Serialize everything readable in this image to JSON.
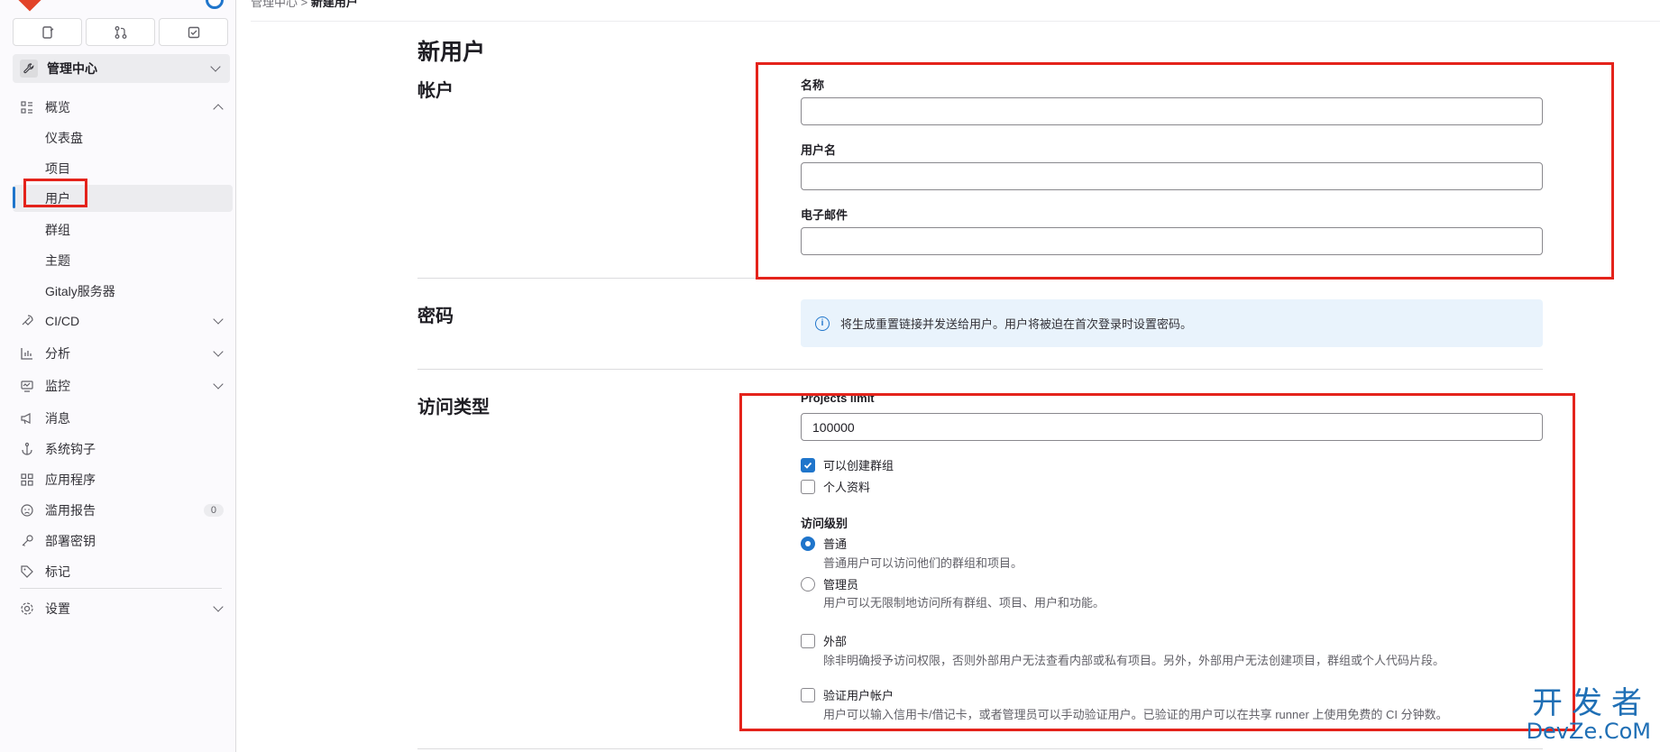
{
  "sidebar": {
    "context_label": "管理中心",
    "items": [
      {
        "label": "概览",
        "icon": "overview-icon"
      },
      {
        "label": "仪表盘"
      },
      {
        "label": "项目"
      },
      {
        "label": "用户"
      },
      {
        "label": "群组"
      },
      {
        "label": "主题"
      },
      {
        "label": "Gitaly服务器"
      },
      {
        "label": "CI/CD",
        "icon": "rocket-icon"
      },
      {
        "label": "分析",
        "icon": "chart-icon"
      },
      {
        "label": "监控",
        "icon": "monitor-icon"
      },
      {
        "label": "消息",
        "icon": "bullhorn-icon"
      },
      {
        "label": "系统钩子",
        "icon": "anchor-icon"
      },
      {
        "label": "应用程序",
        "icon": "applications-icon"
      },
      {
        "label": "滥用报告",
        "icon": "abuse-icon",
        "count": "0"
      },
      {
        "label": "部署密钥",
        "icon": "key-icon"
      },
      {
        "label": "标记",
        "icon": "label-icon"
      },
      {
        "label": "设置",
        "icon": "settings-icon"
      }
    ]
  },
  "breadcrumb": {
    "parent": "管理中心",
    "sep": ">",
    "current": "新建用户"
  },
  "page": {
    "title": "新用户",
    "account": {
      "heading": "帐户",
      "name_label": "名称",
      "name_value": "",
      "username_label": "用户名",
      "username_value": "",
      "email_label": "电子邮件",
      "email_value": ""
    },
    "password": {
      "heading": "密码",
      "info": "将生成重置链接并发送给用户。用户将被迫在首次登录时设置密码。"
    },
    "access": {
      "heading": "访问类型",
      "projects_limit_label": "Projects limit",
      "projects_limit_value": "100000",
      "can_create_group": "可以创建群组",
      "private_profile": "个人资料",
      "access_level_label": "访问级别",
      "regular": "普通",
      "regular_help": "普通用户可以访问他们的群组和项目。",
      "admin": "管理员",
      "admin_help": "用户可以无限制地访问所有群组、项目、用户和功能。",
      "external": "外部",
      "external_help": "除非明确授予访问权限，否则外部用户无法查看内部或私有项目。另外，外部用户无法创建项目，群组或个人代码片段。",
      "validate": "验证用户帐户",
      "validate_help": "用户可以输入信用卡/借记卡，或者管理员可以手动验证用户。已验证的用户可以在共享 runner 上使用免费的 CI 分钟数。"
    }
  },
  "watermark": {
    "line1": "开发者",
    "line2": "DevZe.CoM"
  },
  "colors": {
    "accent": "#1f75cb",
    "highlight": "#e4231b"
  }
}
